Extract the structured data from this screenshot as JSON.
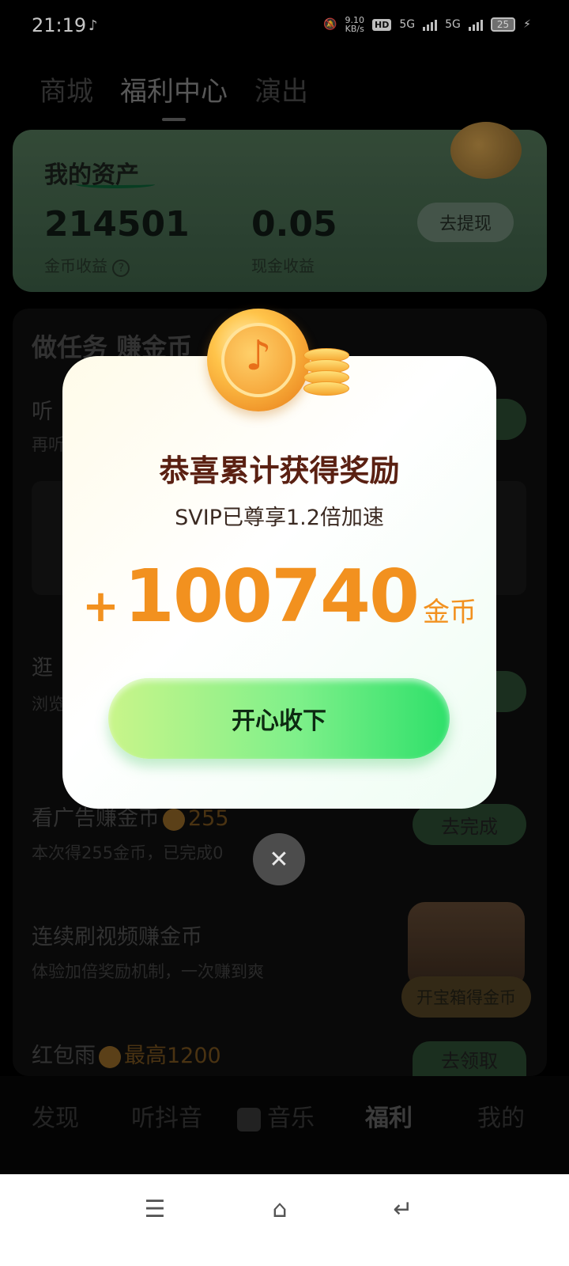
{
  "status": {
    "time": "21:19",
    "speed_top": "9.10",
    "speed_bottom": "KB/s",
    "hd": "HD",
    "net1": "5G",
    "net2": "5G",
    "battery": "25"
  },
  "tabs": [
    {
      "label": "商城"
    },
    {
      "label": "福利中心"
    },
    {
      "label": "演出"
    }
  ],
  "assets": {
    "title": "我的资产",
    "coins": "214501",
    "coins_label": "金币收益",
    "cash": "0.05",
    "cash_label": "现金收益",
    "withdraw_label": "去提现"
  },
  "tasks": {
    "header": "做任务 赚金币",
    "items": [
      {
        "name": "听",
        "desc": "再听"
      },
      {
        "name": "逛",
        "desc": "浏览"
      },
      {
        "name": "看广告赚金币",
        "reward": "255",
        "desc": "本次得255金币，已完成0",
        "button": "去完成"
      },
      {
        "name": "连续刷视频赚金币",
        "desc": "体验加倍奖励机制，一次赚到爽",
        "button": "开宝箱得金币"
      },
      {
        "name": "红包雨",
        "reward": "最高1200",
        "button": "去领取"
      }
    ]
  },
  "bottom_nav": [
    {
      "label": "发现"
    },
    {
      "label": "听抖音"
    },
    {
      "label": "音乐"
    },
    {
      "label": "福利"
    },
    {
      "label": "我的"
    }
  ],
  "popup": {
    "title": "恭喜累计获得奖励",
    "subtitle": "SVIP已尊享1.2倍加速",
    "plus": "+",
    "amount": "100740",
    "unit": "金币",
    "accept_label": "开心收下",
    "close_symbol": "✕"
  },
  "colors": {
    "reward_orange": "#f2911f",
    "title_brown": "#5a2012",
    "accept_green": "#2ee06a"
  }
}
